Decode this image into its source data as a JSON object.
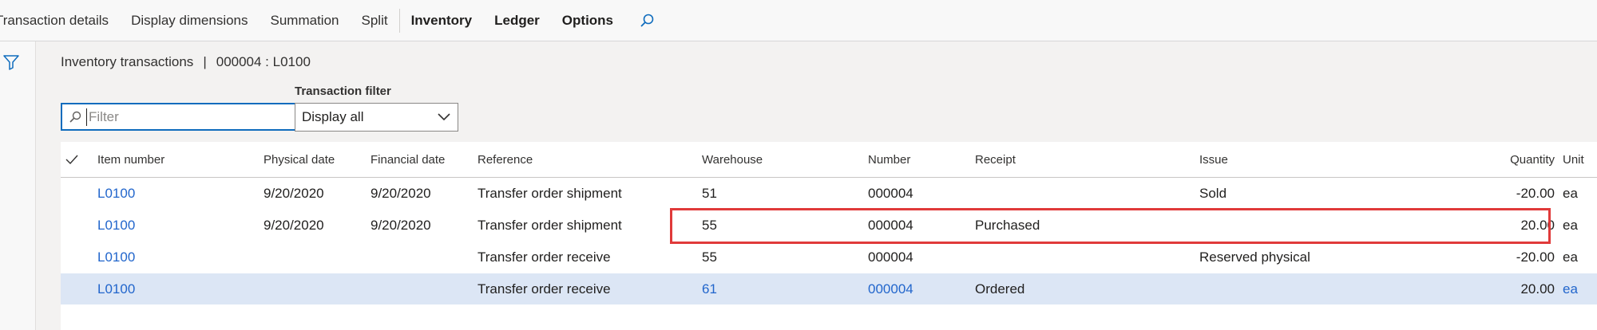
{
  "toolbar": {
    "items": [
      "Transaction details",
      "Display dimensions",
      "Summation",
      "Split"
    ],
    "bold_items": [
      "Inventory",
      "Ledger",
      "Options"
    ],
    "search_icon": "search-icon"
  },
  "leftrail": {
    "filter_icon": "funnel-icon"
  },
  "caption": {
    "title": "Inventory transactions",
    "separator": "|",
    "context": "000004 : L0100"
  },
  "filter": {
    "placeholder": "Filter",
    "value": ""
  },
  "transaction_filter": {
    "label": "Transaction filter",
    "selected": "Display all"
  },
  "grid": {
    "columns": {
      "item": "Item number",
      "physical_date": "Physical date",
      "financial_date": "Financial date",
      "reference": "Reference",
      "warehouse": "Warehouse",
      "number": "Number",
      "receipt": "Receipt",
      "issue": "Issue",
      "quantity": "Quantity",
      "unit": "Unit"
    },
    "rows": [
      {
        "item": "L0100",
        "physical_date": "9/20/2020",
        "financial_date": "9/20/2020",
        "reference": "Transfer order shipment",
        "warehouse": "51",
        "number": "000004",
        "receipt": "",
        "issue": "Sold",
        "quantity": "-20.00",
        "unit": "ea"
      },
      {
        "item": "L0100",
        "physical_date": "9/20/2020",
        "financial_date": "9/20/2020",
        "reference": "Transfer order shipment",
        "warehouse": "55",
        "number": "000004",
        "receipt": "Purchased",
        "issue": "",
        "quantity": "20.00",
        "unit": "ea"
      },
      {
        "item": "L0100",
        "physical_date": "",
        "financial_date": "",
        "reference": "Transfer order receive",
        "warehouse": "55",
        "number": "000004",
        "receipt": "",
        "issue": "Reserved physical",
        "quantity": "-20.00",
        "unit": "ea"
      },
      {
        "item": "L0100",
        "physical_date": "",
        "financial_date": "",
        "reference": "Transfer order receive",
        "warehouse": "61",
        "number": "000004",
        "receipt": "Ordered",
        "issue": "",
        "quantity": "20.00",
        "unit": "ea"
      }
    ]
  },
  "colors": {
    "accent": "#0f6cbd",
    "link": "#2266cc",
    "selected_row": "#dce6f5",
    "highlight": "#e03a3a"
  }
}
